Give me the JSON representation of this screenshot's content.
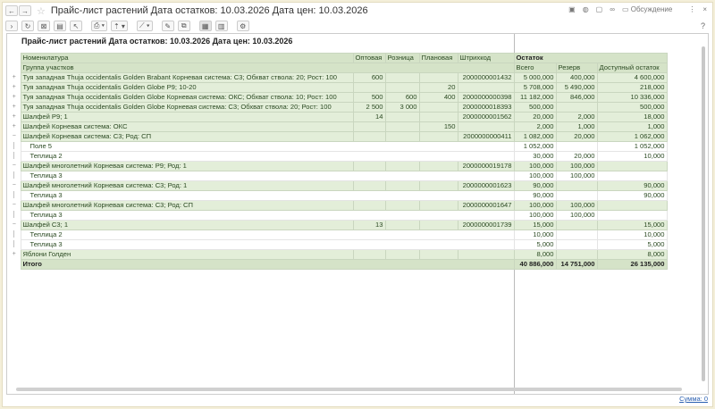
{
  "window": {
    "title": "Прайс-лист растений Дата остатков: 10.03.2026 Дата цен: 10.03.2026",
    "discussion": "Обсуждение",
    "help": "?"
  },
  "report": {
    "title": "Прайс-лист растений Дата остатков: 10.03.2026 Дата цен: 10.03.2026",
    "headers": {
      "name": "Номенклатура",
      "wholesale": "Оптовая",
      "retail": "Розница",
      "planned": "Плановая",
      "barcode": "Штрихкод",
      "stock": "Остаток",
      "group": "Группа участков",
      "total": "Всего",
      "reserve": "Резерв",
      "available": "Доступный остаток"
    },
    "rows": [
      {
        "kind": "g",
        "tree": "+",
        "name": "Туя западная Thuja occidentalis Golden Brabant  Корневая система: С3; Обхват ствола: 20; Рост: 100",
        "w": "600",
        "r": "",
        "p": "",
        "b": "2000000001432",
        "t": "5 000,000",
        "res": "400,000",
        "a": "4 600,000"
      },
      {
        "kind": "g",
        "tree": "+",
        "name": "Туя западная Thuja occidentalis Golden Globe  Р9; 10-20",
        "w": "",
        "r": "",
        "p": "20",
        "b": "",
        "t": "5 708,000",
        "res": "5 490,000",
        "a": "218,000"
      },
      {
        "kind": "g",
        "tree": "+",
        "name": "Туя западная Thuja occidentalis Golden Globe  Корневая система: ОКС; Обхват ствола: 10; Рост: 100",
        "w": "500",
        "r": "600",
        "p": "400",
        "b": "2000000000398",
        "t": "11 182,000",
        "res": "846,000",
        "a": "10 336,000"
      },
      {
        "kind": "g",
        "tree": "+",
        "name": "Туя западная Thuja occidentalis Golden Globe  Корневая система: С3; Обхват ствола: 20; Рост: 100",
        "w": "2 500",
        "r": "3 000",
        "p": "",
        "b": "2000000018393",
        "t": "500,000",
        "res": "",
        "a": "500,000"
      },
      {
        "kind": "g",
        "tree": "+",
        "name": "Шалфей Р9; 1",
        "w": "14",
        "r": "",
        "p": "",
        "b": "2000000001562",
        "t": "20,000",
        "res": "2,000",
        "a": "18,000"
      },
      {
        "kind": "g",
        "tree": "+",
        "name": "Шалфей Корневая система: ОКС",
        "w": "",
        "r": "",
        "p": "150",
        "b": "",
        "t": "2,000",
        "res": "1,000",
        "a": "1,000"
      },
      {
        "kind": "g",
        "tree": "−",
        "name": "Шалфей Корневая система: С3; Род: СП",
        "w": "",
        "r": "",
        "p": "",
        "b": "2000000000411",
        "t": "1 082,000",
        "res": "20,000",
        "a": "1 062,000"
      },
      {
        "kind": "w",
        "tree": "",
        "name": "Поле 5",
        "w": "",
        "r": "",
        "p": "",
        "b": "",
        "t": "1 052,000",
        "res": "",
        "a": "1 052,000"
      },
      {
        "kind": "w",
        "tree": "",
        "name": "Теплица 2",
        "w": "",
        "r": "",
        "p": "",
        "b": "",
        "t": "30,000",
        "res": "20,000",
        "a": "10,000"
      },
      {
        "kind": "g",
        "tree": "−",
        "name": "Шалфей многолетний Корневая система: Р9; Род: 1",
        "w": "",
        "r": "",
        "p": "",
        "b": "2000000019178",
        "t": "100,000",
        "res": "100,000",
        "a": ""
      },
      {
        "kind": "w",
        "tree": "",
        "name": "Теплица 3",
        "w": "",
        "r": "",
        "p": "",
        "b": "",
        "t": "100,000",
        "res": "100,000",
        "a": ""
      },
      {
        "kind": "g",
        "tree": "−",
        "name": "Шалфей многолетний Корневая система: С3; Род: 1",
        "w": "",
        "r": "",
        "p": "",
        "b": "2000000001623",
        "t": "90,000",
        "res": "",
        "a": "90,000"
      },
      {
        "kind": "w",
        "tree": "",
        "name": "Теплица 3",
        "w": "",
        "r": "",
        "p": "",
        "b": "",
        "t": "90,000",
        "res": "",
        "a": "90,000"
      },
      {
        "kind": "g",
        "tree": "−",
        "name": "Шалфей многолетний Корневая система: С3; Род: СП",
        "w": "",
        "r": "",
        "p": "",
        "b": "2000000001647",
        "t": "100,000",
        "res": "100,000",
        "a": ""
      },
      {
        "kind": "w",
        "tree": "",
        "name": "Теплица 3",
        "w": "",
        "r": "",
        "p": "",
        "b": "",
        "t": "100,000",
        "res": "100,000",
        "a": ""
      },
      {
        "kind": "g",
        "tree": "−",
        "name": "Шалфей С3; 1",
        "w": "13",
        "r": "",
        "p": "",
        "b": "2000000001739",
        "t": "15,000",
        "res": "",
        "a": "15,000"
      },
      {
        "kind": "w",
        "tree": "",
        "name": "Теплица 2",
        "w": "",
        "r": "",
        "p": "",
        "b": "",
        "t": "10,000",
        "res": "",
        "a": "10,000"
      },
      {
        "kind": "w",
        "tree": "",
        "name": "Теплица 3",
        "w": "",
        "r": "",
        "p": "",
        "b": "",
        "t": "5,000",
        "res": "",
        "a": "5,000"
      },
      {
        "kind": "g",
        "tree": "+",
        "name": "Яблони Голден",
        "w": "",
        "r": "",
        "p": "",
        "b": "",
        "t": "8,000",
        "res": "",
        "a": "8,000"
      }
    ],
    "totals": {
      "label": "Итого",
      "t": "40 886,000",
      "res": "14 751,000",
      "a": "26 135,000"
    }
  },
  "footer": {
    "sum": "Сумма: 0"
  }
}
